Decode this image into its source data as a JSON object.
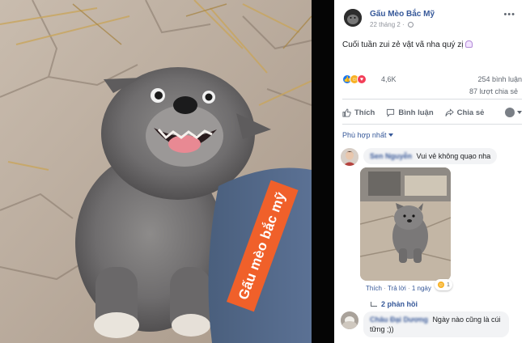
{
  "photo": {
    "watermark": "Gấu mèo bắc mỹ",
    "alt_subject": "grey fluffy puppy smiling"
  },
  "post": {
    "page_name": "Gấu Mèo Bắc Mỹ",
    "time": "22 tháng 2 · ",
    "more_label": "•••",
    "text": "Cuối tuần zui zẻ vật vã nha quý zị",
    "reaction_count": "4,6K",
    "comment_count": "254 bình luận",
    "share_count": "87 lượt chia sẻ",
    "actions": {
      "like": "Thích",
      "comment": "Bình luận",
      "share": "Chia sẻ"
    },
    "sort_label": "Phù hợp nhất"
  },
  "comments": [
    {
      "name": "Sen Nguyễn",
      "text": "Vui vẻ không quạo nha",
      "meta_like": "Thích",
      "meta_reply": "Trả lời",
      "meta_time": "1 ngày",
      "reaction_count": "1",
      "replies_label": "2 phản hồi"
    },
    {
      "name": "Châu Đại Dương",
      "text": "Ngày nào cũng là cúi",
      "text2": "tững ;))"
    }
  ],
  "colors": {
    "link_blue": "#365899",
    "watermark_orange": "#f0602a",
    "like_blue": "#1877f2"
  }
}
